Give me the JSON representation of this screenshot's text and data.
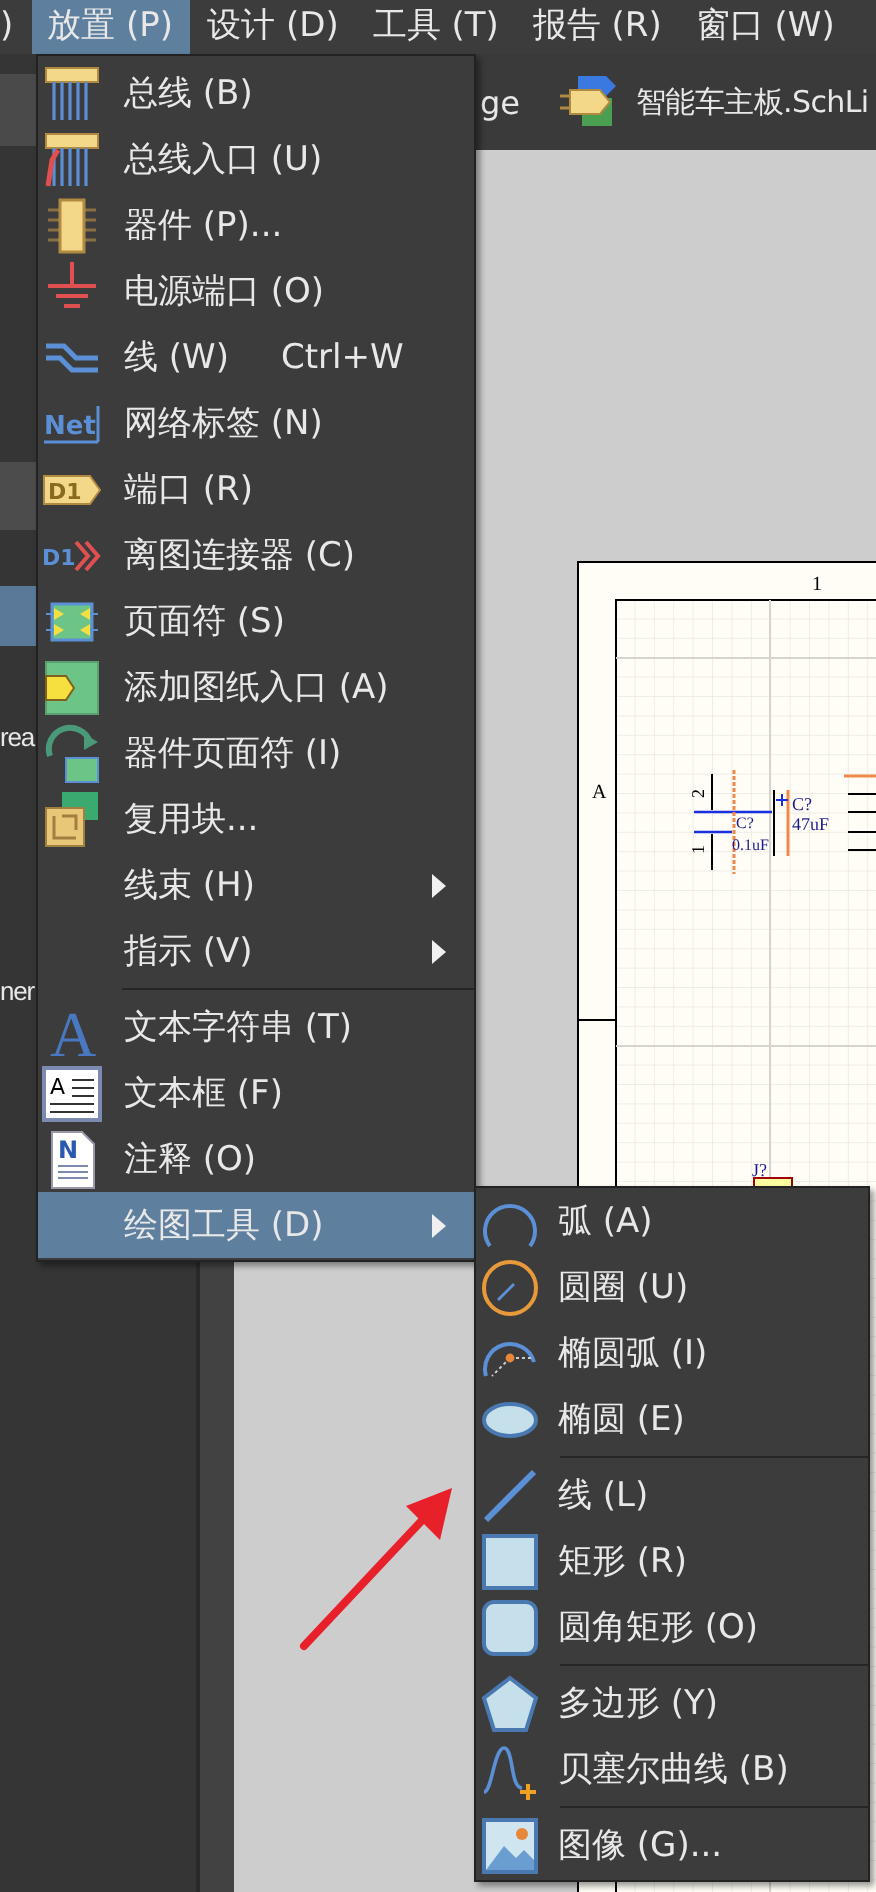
{
  "menubar": [
    {
      "label": ")",
      "selected": false
    },
    {
      "label": "放置 (P)",
      "selected": true
    },
    {
      "label": "设计 (D)",
      "selected": false
    },
    {
      "label": "工具 (T)",
      "selected": false
    },
    {
      "label": "报告 (R)",
      "selected": false
    },
    {
      "label": "窗口 (W)",
      "selected": false
    }
  ],
  "left_panel": {
    "rows": [
      {
        "selected": true
      },
      {
        "label": "rea",
        "selected": false
      },
      {
        "label": "ner",
        "selected": false
      }
    ]
  },
  "tabs": [
    {
      "label": "ge"
    },
    {
      "label": "智能车主板.SchLi"
    }
  ],
  "schematic": {
    "column_label": "1",
    "row_label": "A",
    "parts": [
      {
        "designator": "C?",
        "value": "0.1uF",
        "pins": [
          "2",
          "1"
        ]
      },
      {
        "designator": "C?",
        "value": "47uF",
        "polarized": true
      },
      {
        "designator": "J?"
      }
    ]
  },
  "main_menu": {
    "items": [
      {
        "label": "总线 (B)",
        "selected": false
      },
      {
        "label": "总线入口 (U)",
        "selected": false
      },
      {
        "label": "器件 (P)...",
        "selected": false
      },
      {
        "label": "电源端口 (O)",
        "selected": false
      },
      {
        "label": "线 (W)",
        "shortcut": "Ctrl+W",
        "selected": false
      },
      {
        "label": "网络标签 (N)",
        "icon_text": "Net",
        "selected": false
      },
      {
        "label": "端口 (R)",
        "icon_text": "D1",
        "selected": false
      },
      {
        "label": "离图连接器 (C)",
        "icon_text": "D1",
        "selected": false
      },
      {
        "label": "页面符 (S)",
        "selected": false
      },
      {
        "label": "添加图纸入口 (A)",
        "selected": false
      },
      {
        "label": "器件页面符 (I)",
        "selected": false
      },
      {
        "label": "复用块...",
        "selected": false
      },
      {
        "label": "线束 (H)",
        "submenu": true,
        "selected": false
      },
      {
        "label": "指示 (V)",
        "submenu": true,
        "selected": false
      },
      {
        "label": "文本字符串 (T)",
        "icon_text": "A",
        "separator_before": true,
        "selected": false
      },
      {
        "label": "文本框 (F)",
        "icon_text": "A",
        "selected": false
      },
      {
        "label": "注释 (O)",
        "icon_text": "N",
        "selected": false
      },
      {
        "label": "绘图工具 (D)",
        "submenu": true,
        "selected": true
      }
    ]
  },
  "submenu": {
    "items": [
      {
        "label": "弧 (A)",
        "selected": false
      },
      {
        "label": "圆圈 (U)",
        "selected": false
      },
      {
        "label": "椭圆弧 (I)",
        "selected": false
      },
      {
        "label": "椭圆 (E)",
        "selected": false
      },
      {
        "label": "线 (L)",
        "separator_before": true,
        "selected": false
      },
      {
        "label": "矩形 (R)",
        "selected": false
      },
      {
        "label": "圆角矩形 (O)",
        "selected": false
      },
      {
        "label": "多边形 (Y)",
        "separator_before": true,
        "selected": false
      },
      {
        "label": "贝塞尔曲线 (B)",
        "selected": false
      },
      {
        "label": "图像 (G)...",
        "separator_before": true,
        "selected": false
      }
    ]
  }
}
